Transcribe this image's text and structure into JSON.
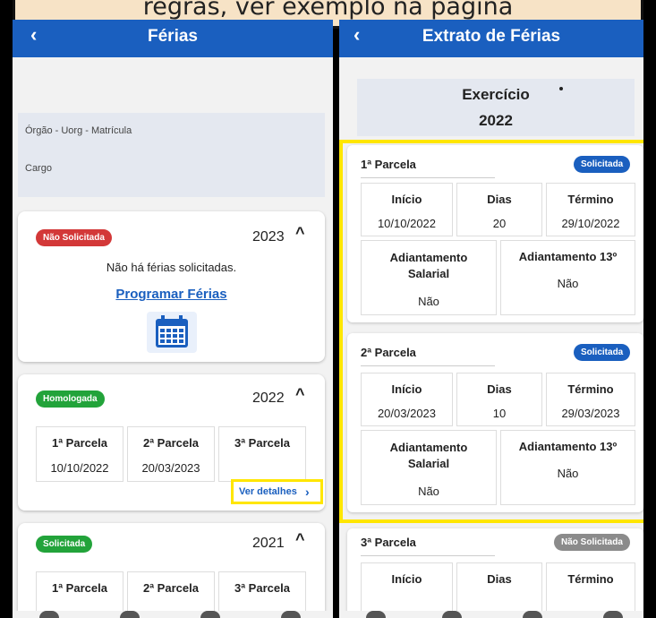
{
  "caption": "regras, ver exemplo na página",
  "left_screen": {
    "title": "Férias",
    "back_icon": "‹",
    "info": {
      "orgao_label": "Órgão - Uorg - Matrícula",
      "cargo_label": "Cargo"
    },
    "cards": [
      {
        "status": "Não Solicitada",
        "year": "2023",
        "message": "Não há férias solicitadas.",
        "link": "Programar Férias"
      },
      {
        "status": "Homologada",
        "year": "2022",
        "parcelas": [
          {
            "label": "1ª Parcela",
            "date": "10/10/2022"
          },
          {
            "label": "2ª Parcela",
            "date": "20/03/2023"
          },
          {
            "label": "3ª Parcela",
            "date": ""
          }
        ],
        "details": "Ver detalhes"
      },
      {
        "status": "Solicitada",
        "year": "2021",
        "parcelas": [
          {
            "label": "1ª Parcela"
          },
          {
            "label": "2ª Parcela"
          },
          {
            "label": "3ª Parcela"
          }
        ]
      }
    ]
  },
  "right_screen": {
    "title": "Extrato de Férias",
    "back_icon": "‹",
    "exercicio_label": "Exercício",
    "exercicio_year": "2022",
    "parcelas": [
      {
        "title": "1ª Parcela",
        "status": "Solicitada",
        "inicio_label": "Início",
        "inicio": "10/10/2022",
        "dias_label": "Dias",
        "dias": "20",
        "termino_label": "Término",
        "termino": "29/10/2022",
        "adiant_salarial_label": "Adiantamento Salarial",
        "adiant_salarial": "Não",
        "adiant_13_label": "Adiantamento 13º",
        "adiant_13": "Não"
      },
      {
        "title": "2ª Parcela",
        "status": "Solicitada",
        "inicio_label": "Início",
        "inicio": "20/03/2023",
        "dias_label": "Dias",
        "dias": "10",
        "termino_label": "Término",
        "termino": "29/03/2023",
        "adiant_salarial_label": "Adiantamento Salarial",
        "adiant_salarial": "Não",
        "adiant_13_label": "Adiantamento 13º",
        "adiant_13": "Não"
      },
      {
        "title": "3ª Parcela",
        "status": "Não Solicitada",
        "inicio_label": "Início",
        "dias_label": "Dias",
        "termino_label": "Término"
      }
    ]
  }
}
